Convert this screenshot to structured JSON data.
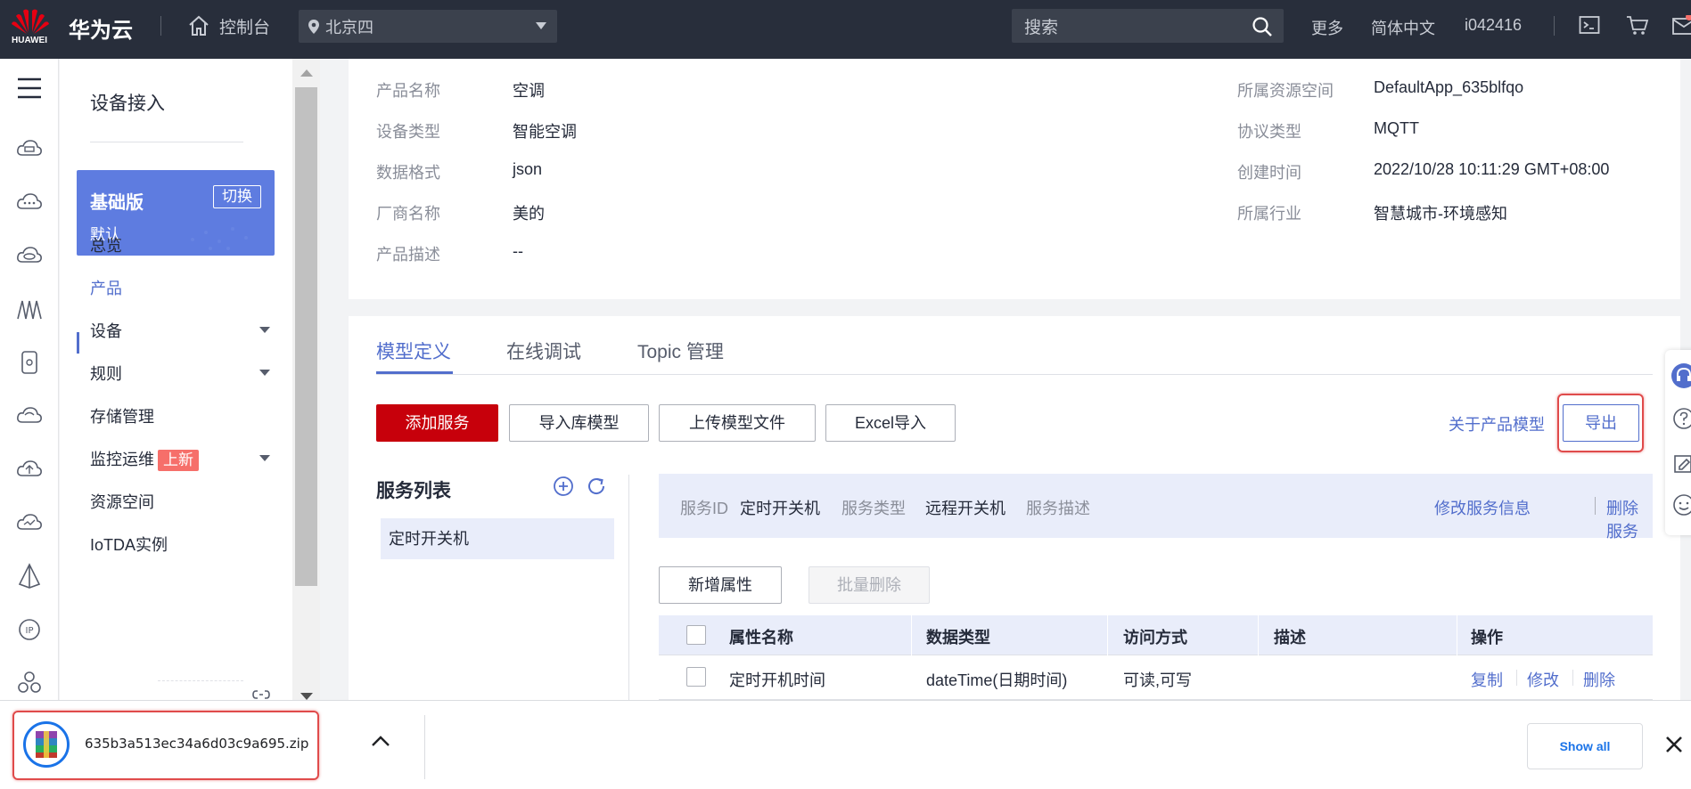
{
  "topbar": {
    "logo_text": "HUAWEI",
    "brand": "华为云",
    "console": "控制台",
    "region": "北京四",
    "search_placeholder": "搜索",
    "more": "更多",
    "language": "简体中文",
    "user": "i042416"
  },
  "sidebar": {
    "title": "设备接入",
    "edition": {
      "name": "基础版",
      "switch": "切换",
      "sub": "默认"
    },
    "items": [
      {
        "label": "总览"
      },
      {
        "label": "产品"
      },
      {
        "label": "设备"
      },
      {
        "label": "规则"
      },
      {
        "label": "存储管理"
      },
      {
        "label": "监控运维",
        "badge": "上新"
      },
      {
        "label": "资源空间"
      },
      {
        "label": "IoTDA实例"
      }
    ]
  },
  "product_info": {
    "left": [
      {
        "label": "产品名称",
        "value": "空调"
      },
      {
        "label": "设备类型",
        "value": "智能空调"
      },
      {
        "label": "数据格式",
        "value": "json"
      },
      {
        "label": "厂商名称",
        "value": "美的"
      },
      {
        "label": "产品描述",
        "value": "--"
      }
    ],
    "right": [
      {
        "label": "所属资源空间",
        "value": "DefaultApp_635blfqo"
      },
      {
        "label": "协议类型",
        "value": "MQTT"
      },
      {
        "label": "创建时间",
        "value": "2022/10/28 10:11:29 GMT+08:00"
      },
      {
        "label": "所属行业",
        "value": "智慧城市-环境感知"
      }
    ]
  },
  "model": {
    "tabs": [
      "模型定义",
      "在线调试",
      "Topic 管理"
    ],
    "buttons": {
      "add_service": "添加服务",
      "import_library": "导入库模型",
      "upload_file": "上传模型文件",
      "excel_import": "Excel导入",
      "about": "关于产品模型",
      "export": "导出"
    },
    "service_list_title": "服务列表",
    "services": [
      "定时开关机"
    ],
    "service_info": {
      "id_label": "服务ID",
      "id_value": "定时开关机",
      "type_label": "服务类型",
      "type_value": "远程开关机",
      "desc_label": "服务描述",
      "edit": "修改服务信息",
      "delete": "删除服务"
    },
    "add_property": "新增属性",
    "batch_delete": "批量删除",
    "table": {
      "headers": [
        "属性名称",
        "数据类型",
        "访问方式",
        "描述",
        "操作"
      ],
      "rows": [
        {
          "name": "定时开机时间",
          "type": "dateTime(日期时间)",
          "access": "可读,可写",
          "desc": "",
          "ops": [
            "复制",
            "修改",
            "删除"
          ]
        }
      ]
    }
  },
  "download_bar": {
    "file_name": "635b3a513ec34a6d03c9a695.zip",
    "show_all": "Show all"
  },
  "colors": {
    "topbar": "#282e3b",
    "accent": "#526ecc",
    "primary_button": "#c7000b",
    "edition_card": "#5e7ce0",
    "highlight_outline": "#e04b4b"
  }
}
